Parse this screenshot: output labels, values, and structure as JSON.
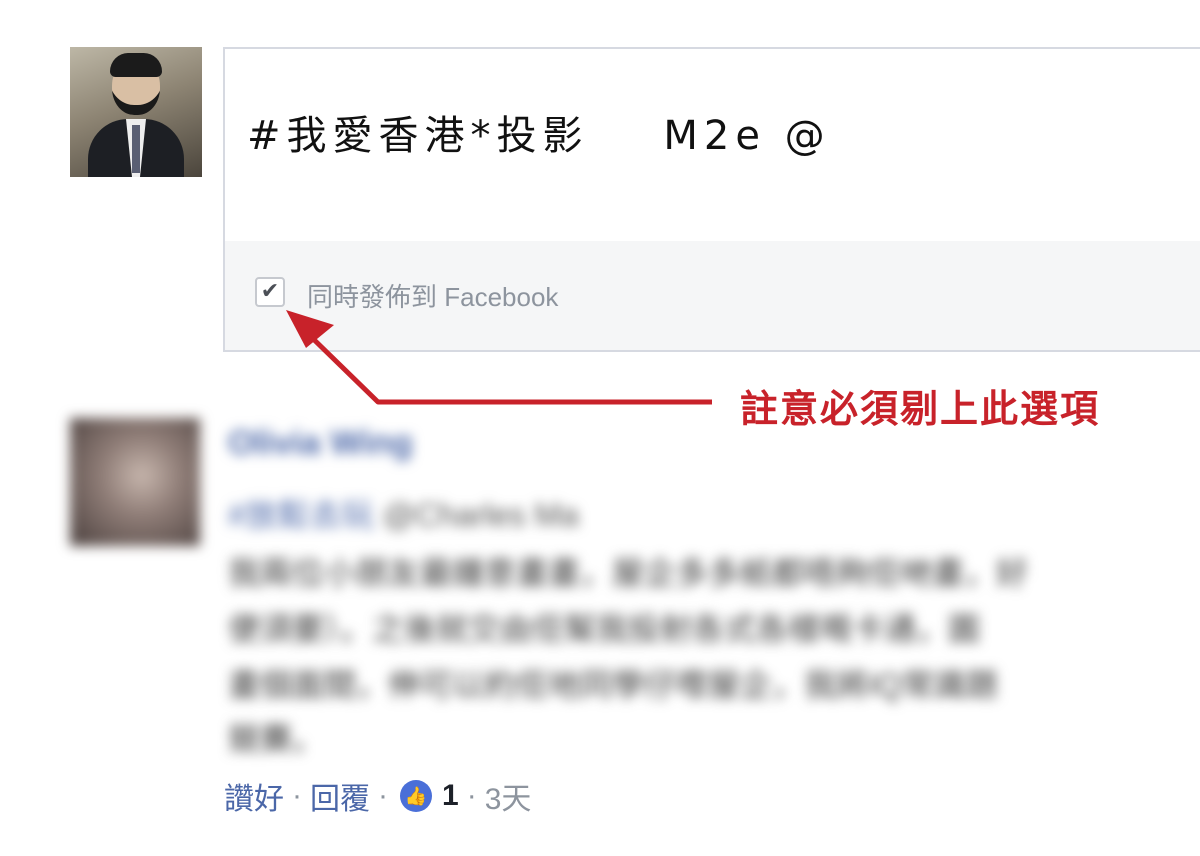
{
  "composer": {
    "text": "#我愛香港*投影    M2e @",
    "share_checkbox": {
      "checked": true,
      "label": "同時發佈到 Facebook"
    }
  },
  "annotation": {
    "text": "註意必須剔上此選項",
    "color": "#c8222a"
  },
  "comment": {
    "author": "Olivia Wing",
    "hashtag": "#放鬆去玩",
    "mention": "@Charles Ma",
    "body_lines": [
      "我兩位小朋友最鍾意畫畫，屋企多多紙都唔夠佢哋畫，好",
      "便須要）。之後就交由佢幫我投射各式各樣嘅卡通，圖",
      "畫個面間，伸可以約佢地同學仔嚟屋企，我將IQ常識題",
      "競賽。"
    ],
    "actions": {
      "like_label": "讚好",
      "reply_label": "回覆",
      "separator": "·",
      "like_count": "1",
      "time": "3天"
    }
  },
  "colors": {
    "link": "#4b67a8",
    "annotation": "#c8222a",
    "like_badge": "#4a6fd8"
  }
}
